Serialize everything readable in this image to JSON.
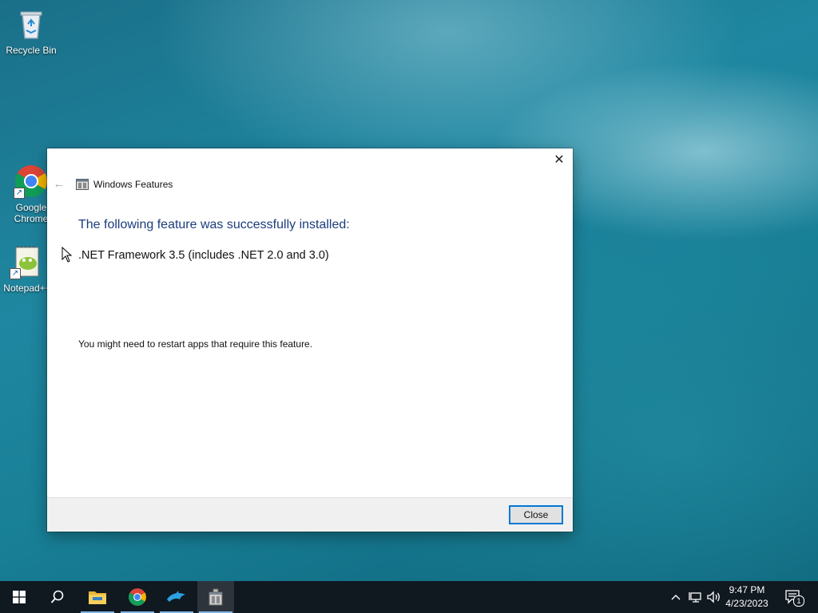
{
  "desktop": {
    "icons": [
      {
        "label": "Recycle Bin",
        "icon": "recycle-bin-icon"
      },
      {
        "label": "Google Chrome",
        "icon": "chrome-icon"
      },
      {
        "label": "Notepad++",
        "icon": "notepad-plus-plus-icon"
      }
    ]
  },
  "window": {
    "title": "Windows Features",
    "heading": "The following feature was successfully installed:",
    "feature": ".NET Framework 3.5 (includes .NET 2.0 and 3.0)",
    "note": "You might need to restart apps that require this feature.",
    "close_button_label": "Close",
    "close_glyph": "✕",
    "back_glyph": "←"
  },
  "taskbar": {
    "items": [
      {
        "name": "start",
        "icon": "windows-start-icon"
      },
      {
        "name": "search",
        "icon": "search-icon"
      },
      {
        "name": "file-explorer",
        "icon": "folder-icon"
      },
      {
        "name": "chrome",
        "icon": "chrome-icon"
      },
      {
        "name": "app",
        "icon": "dolphin-icon"
      },
      {
        "name": "windows-features",
        "icon": "windows-features-icon",
        "active": true
      }
    ],
    "tray": {
      "time": "9:47 PM",
      "date": "4/23/2023",
      "notification_count": "1"
    }
  },
  "colors": {
    "accent": "#0078d7",
    "heading": "#1c3c7c"
  }
}
